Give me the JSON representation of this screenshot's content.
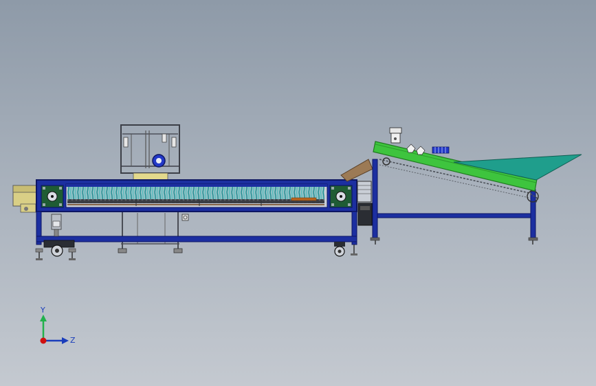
{
  "triad": {
    "y_label": "Y",
    "z_label": "Z"
  },
  "colors": {
    "frame_blue": "#1c2fa0",
    "frame_dark": "#0d1663",
    "belt_green": "#3ec43e",
    "hopper_teal": "#1f9e8c",
    "fan_teal": "#2aa8a8",
    "chute_brown": "#9c7a55",
    "axis_y": "#22b14c",
    "axis_z": "#1a3dbb",
    "axis_x": "#d01010"
  }
}
